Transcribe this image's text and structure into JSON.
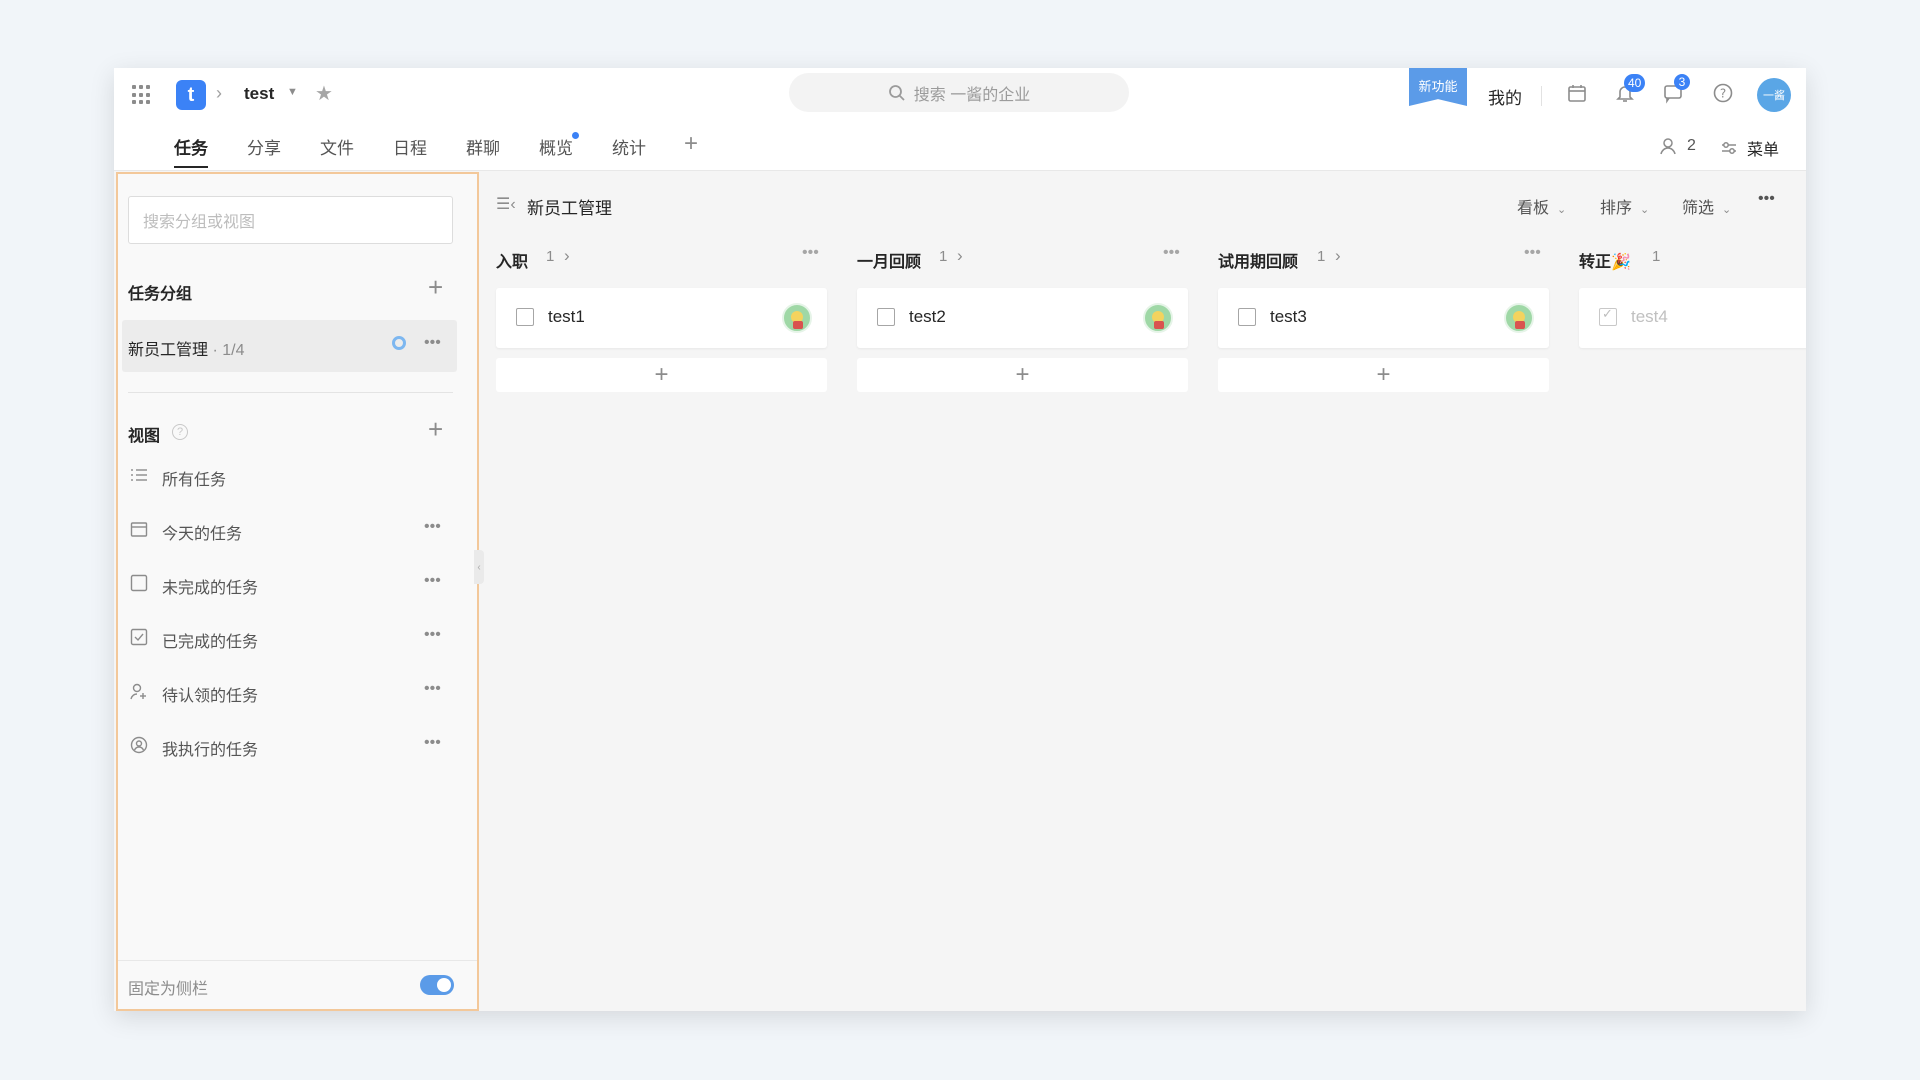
{
  "topbar": {
    "project_logo": "t",
    "project_name": "test",
    "search_placeholder": "搜索 一酱的企业",
    "new_feature": "新功能",
    "mine": "我的",
    "notify_badge": "40",
    "message_badge": "3",
    "avatar_text": "一酱"
  },
  "tabs": [
    {
      "label": "任务"
    },
    {
      "label": "分享"
    },
    {
      "label": "文件"
    },
    {
      "label": "日程"
    },
    {
      "label": "群聊"
    },
    {
      "label": "概览"
    },
    {
      "label": "统计"
    }
  ],
  "tab_add": "+",
  "members_count": "2",
  "menu_label": "菜单",
  "sidebar": {
    "search_placeholder": "搜索分组或视图",
    "groups_title": "任务分组",
    "group": {
      "name": "新员工管理",
      "count": " · 1/4"
    },
    "views_title": "视图",
    "views": [
      {
        "label": "所有任务",
        "icon": "list-icon"
      },
      {
        "label": "今天的任务",
        "icon": "calendar-icon"
      },
      {
        "label": "未完成的任务",
        "icon": "checkbox-empty-icon"
      },
      {
        "label": "已完成的任务",
        "icon": "checkbox-checked-icon"
      },
      {
        "label": "待认领的任务",
        "icon": "user-add-icon"
      },
      {
        "label": "我执行的任务",
        "icon": "user-circle-icon"
      }
    ],
    "pin_label": "固定为侧栏",
    "pin_on": true
  },
  "board": {
    "title": "新员工管理",
    "view_mode": "看板",
    "sort": "排序",
    "filter": "筛选",
    "columns": [
      {
        "title": "入职",
        "count": "1",
        "task": "test1",
        "done": false
      },
      {
        "title": "一月回顾",
        "count": "1",
        "task": "test2",
        "done": false
      },
      {
        "title": "试用期回顾",
        "count": "1",
        "task": "test3",
        "done": false
      },
      {
        "title": "转正🎉",
        "count": "1",
        "task": "test4",
        "done": true
      }
    ]
  },
  "colors": {
    "accent": "#3b82f6",
    "sidebar_highlight_border": "#f3c89a"
  }
}
